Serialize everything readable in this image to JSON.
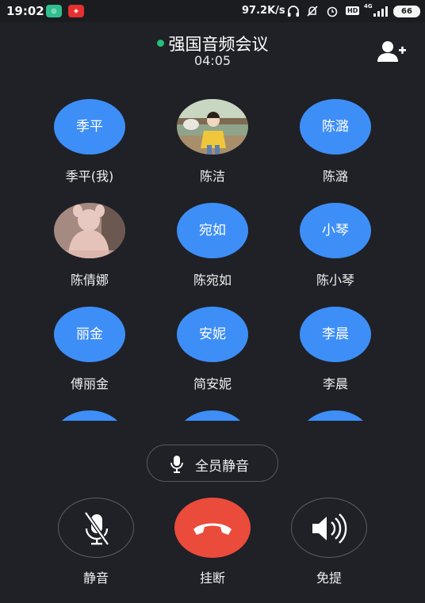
{
  "status_bar": {
    "time": "19:02",
    "speed": "97.2K/s",
    "hd": "HD",
    "network": "4G",
    "battery": "66",
    "icons": [
      "headphones-icon",
      "mute-bell-icon",
      "alarm-icon",
      "signal-icon"
    ]
  },
  "header": {
    "title": "强国音频会议",
    "timer": "04:05",
    "status_color": "#23c07a",
    "add_icon": "add-person-icon"
  },
  "participants": [
    {
      "avatar_text": "季平",
      "name": "季平(我)",
      "avatar": "text"
    },
    {
      "avatar_text": "",
      "name": "陈洁",
      "avatar": "photo"
    },
    {
      "avatar_text": "陈潞",
      "name": "陈潞",
      "avatar": "text"
    },
    {
      "avatar_text": "",
      "name": "陈倩娜",
      "avatar": "photo"
    },
    {
      "avatar_text": "宛如",
      "name": "陈宛如",
      "avatar": "text"
    },
    {
      "avatar_text": "小琴",
      "name": "陈小琴",
      "avatar": "text"
    },
    {
      "avatar_text": "丽金",
      "name": "傅丽金",
      "avatar": "text"
    },
    {
      "avatar_text": "安妮",
      "name": "简安妮",
      "avatar": "text"
    },
    {
      "avatar_text": "李晨",
      "name": "李晨",
      "avatar": "text"
    }
  ],
  "mute_all": {
    "label": "全员静音",
    "icon": "microphone-icon"
  },
  "controls": {
    "mute": {
      "label": "静音",
      "icon": "mic-off-icon"
    },
    "hangup": {
      "label": "挂断",
      "icon": "phone-hangup-icon",
      "color": "#ea4b3b"
    },
    "speaker": {
      "label": "免提",
      "icon": "speaker-icon"
    }
  },
  "colors": {
    "background": "#1f2126",
    "avatar": "#3e8ef7"
  }
}
